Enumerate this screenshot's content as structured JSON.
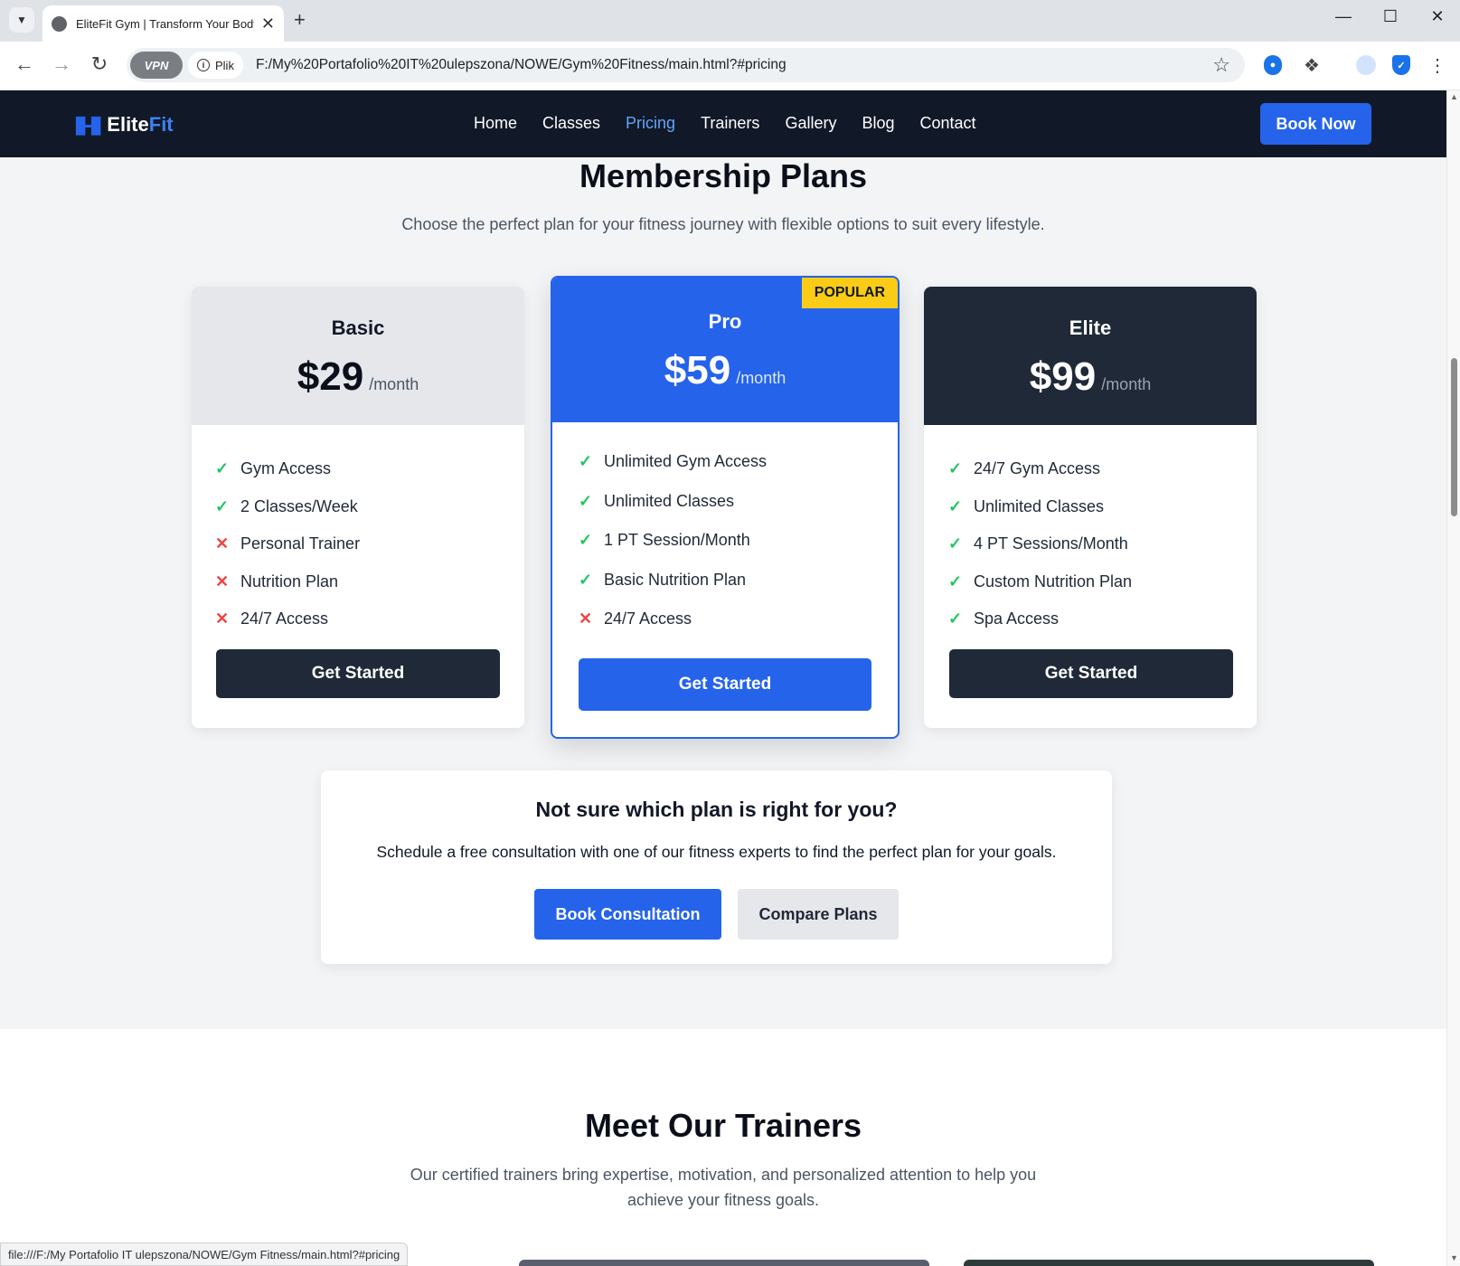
{
  "browser": {
    "tab_title": "EliteFit Gym | Transform Your Body",
    "url_badge": "Plik",
    "vpn_label": "VPN",
    "url": "F:/My%20Portafolio%20IT%20ulepszona/NOWE/Gym%20Fitness/main.html?#pricing",
    "status_url": "file:///F:/My Portafolio IT ulepszona/NOWE/Gym Fitness/main.html?#pricing"
  },
  "nav": {
    "logo_main": "Elite",
    "logo_accent": "Fit",
    "items": [
      {
        "label": "Home",
        "active": false
      },
      {
        "label": "Classes",
        "active": false
      },
      {
        "label": "Pricing",
        "active": true
      },
      {
        "label": "Trainers",
        "active": false
      },
      {
        "label": "Gallery",
        "active": false
      },
      {
        "label": "Blog",
        "active": false
      },
      {
        "label": "Contact",
        "active": false
      }
    ],
    "cta": "Book Now"
  },
  "pricing": {
    "title": "Membership Plans",
    "subtitle": "Choose the perfect plan for your fitness journey with flexible options to suit every lifestyle.",
    "per": "/month",
    "badge": "POPULAR",
    "plans": [
      {
        "name": "Basic",
        "price": "$29",
        "features": [
          {
            "text": "Gym Access",
            "included": true
          },
          {
            "text": "2 Classes/Week",
            "included": true
          },
          {
            "text": "Personal Trainer",
            "included": false
          },
          {
            "text": "Nutrition Plan",
            "included": false
          },
          {
            "text": "24/7 Access",
            "included": false
          }
        ],
        "cta": "Get Started"
      },
      {
        "name": "Pro",
        "price": "$59",
        "features": [
          {
            "text": "Unlimited Gym Access",
            "included": true
          },
          {
            "text": "Unlimited Classes",
            "included": true
          },
          {
            "text": "1 PT Session/Month",
            "included": true
          },
          {
            "text": "Basic Nutrition Plan",
            "included": true
          },
          {
            "text": "24/7 Access",
            "included": false
          }
        ],
        "cta": "Get Started"
      },
      {
        "name": "Elite",
        "price": "$99",
        "features": [
          {
            "text": "24/7 Gym Access",
            "included": true
          },
          {
            "text": "Unlimited Classes",
            "included": true
          },
          {
            "text": "4 PT Sessions/Month",
            "included": true
          },
          {
            "text": "Custom Nutrition Plan",
            "included": true
          },
          {
            "text": "Spa Access",
            "included": true
          }
        ],
        "cta": "Get Started"
      }
    ]
  },
  "consultation": {
    "title": "Not sure which plan is right for you?",
    "text": "Schedule a free consultation with one of our fitness experts to find the perfect plan for your goals.",
    "primary": "Book Consultation",
    "secondary": "Compare Plans"
  },
  "trainers": {
    "title": "Meet Our Trainers",
    "subtitle_line1": "Our certified trainers bring expertise, motivation, and personalized attention to help you",
    "subtitle_line2": "achieve your fitness goals."
  },
  "colors": {
    "primary": "#2563eb",
    "dark": "#1f2937",
    "navy": "#111827",
    "check": "#22c55e",
    "cross": "#ef4444",
    "badge": "#facc15"
  }
}
